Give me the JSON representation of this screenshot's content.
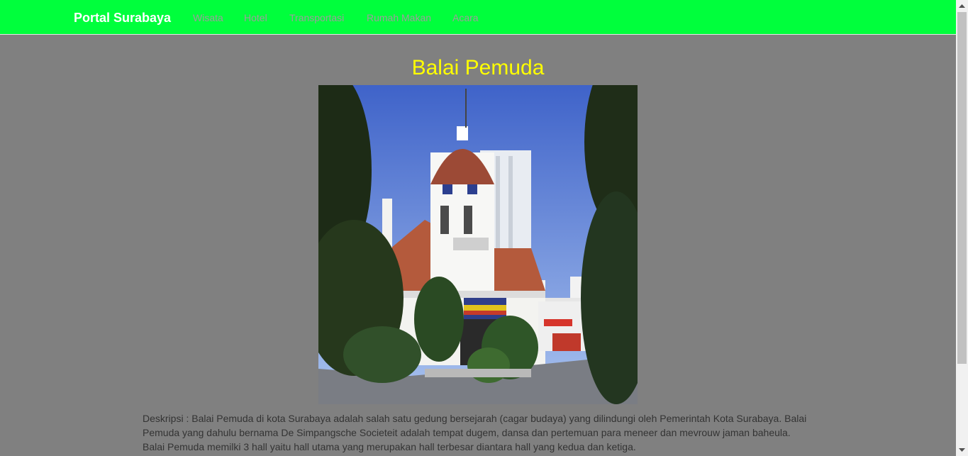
{
  "navbar": {
    "brand": "Portal Surabaya",
    "links": [
      {
        "label": "Wisata"
      },
      {
        "label": "Hotel"
      },
      {
        "label": "Transportasi"
      },
      {
        "label": "Rumah Makan"
      },
      {
        "label": "Acara"
      }
    ]
  },
  "page": {
    "title": "Balai Pemuda",
    "description": "Deskripsi : Balai Pemuda di kota Surabaya adalah salah satu gedung bersejarah (cagar budaya) yang dilindungi oleh Pemerintah Kota Surabaya. Balai Pemuda yang dahulu bernama De Simpangsche Societeit adalah tempat dugem, dansa dan pertemuan para meneer dan mevrouw jaman baheula. Balai Pemuda memilki 3 hall yaitu hall utama yang merupakan hall terbesar diantara hall yang kedua dan ketiga."
  },
  "colors": {
    "navbar_bg": "#00ff3c",
    "page_bg": "#808080",
    "title": "#ffff00",
    "nav_link": "#9d9d9d",
    "brand": "#ffffff"
  },
  "icons": {
    "scroll_up": "chevron-up-icon",
    "scroll_down": "chevron-down-icon"
  }
}
